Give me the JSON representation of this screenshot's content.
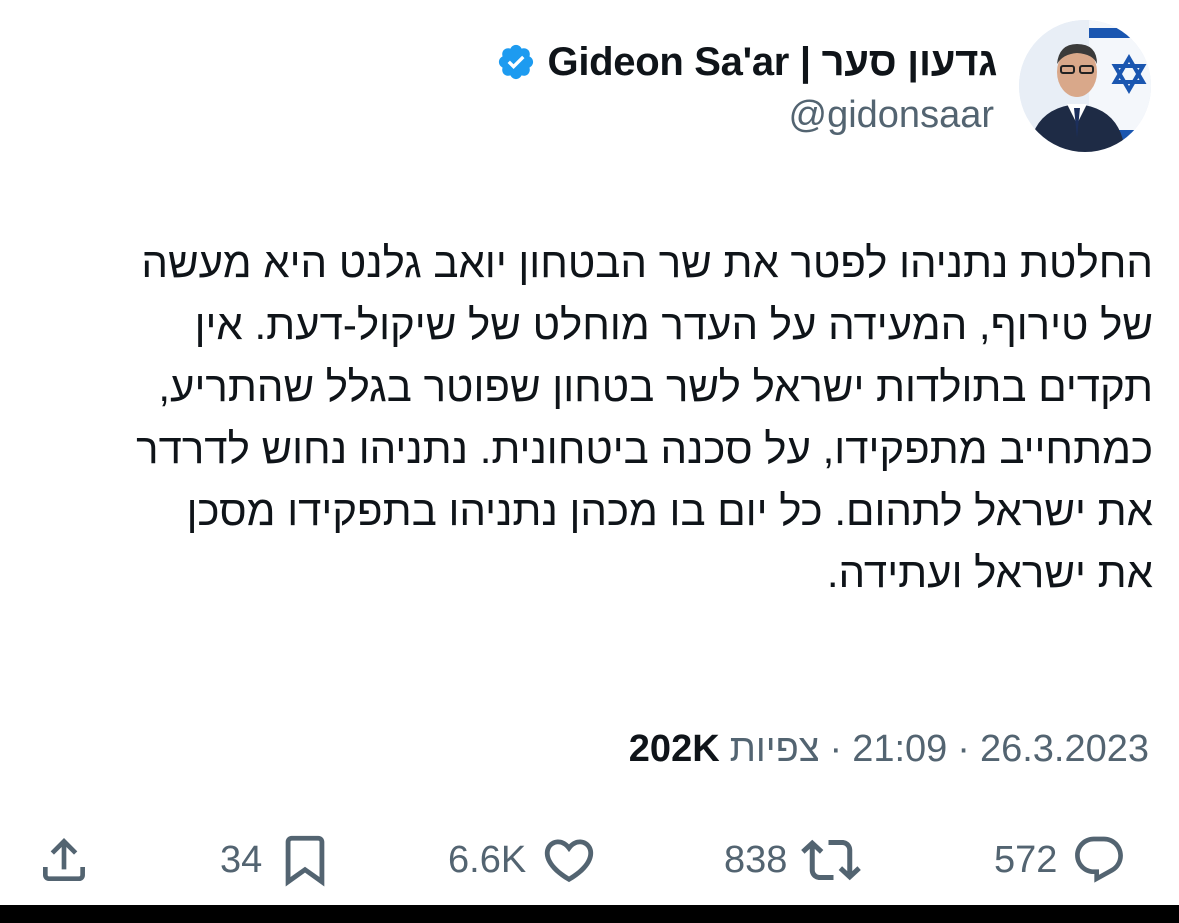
{
  "author": {
    "display_name": "גדעון סער | Gideon Sa'ar",
    "handle": "@gidonsaar",
    "verified": true,
    "verified_icon": "verified-badge-icon"
  },
  "tweet": {
    "lines": [
      "החלטת נתניהו לפטר את שר הבטחון יואב גלנט היא מעשה",
      "של טירוף, המעידה על העדר מוחלט של שיקול-דעת. אין",
      "תקדים בתולדות ישראל לשר בטחון שפוטר בגלל שהתריע,",
      "כמתחייב מתפקידו, על סכנה ביטחונית. נתניהו נחוש לדרדר",
      "את ישראל לתהום. כל יום בו מכהן נתניהו בתפקידו מסכן",
      "את ישראל ועתידה."
    ]
  },
  "meta": {
    "date": "26.3.2023",
    "separator": "·",
    "time": "21:09",
    "views_label": "צפיות",
    "views_count": "202K"
  },
  "actions": {
    "replies": "572",
    "retweets": "838",
    "likes": "6.6K",
    "bookmarks": "34"
  },
  "colors": {
    "text": "#0f1419",
    "muted": "#536471",
    "verified": "#1d9bf0"
  }
}
